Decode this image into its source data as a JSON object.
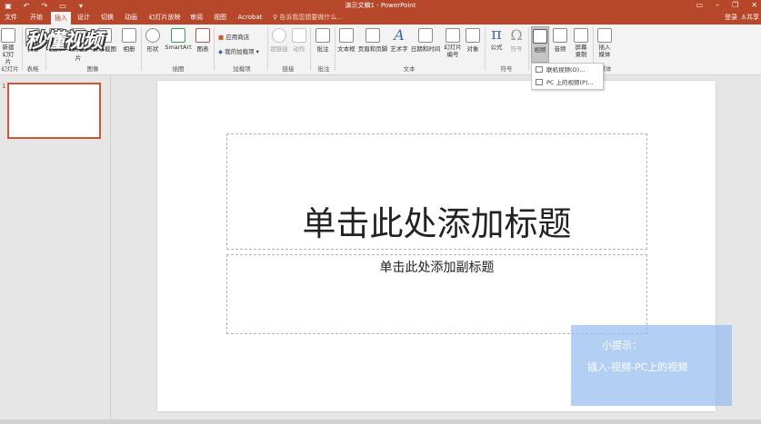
{
  "window": {
    "title": "演示文稿1 - PowerPoint",
    "login": "登录",
    "share": "共享"
  },
  "tabs": [
    "文件",
    "开始",
    "插入",
    "设计",
    "切换",
    "动画",
    "幻灯片放映",
    "审阅",
    "视图",
    "Acrobat"
  ],
  "active_tab": "插入",
  "tell_me": "告诉我您想要做什么...",
  "ribbon": {
    "new_slide": "新建\n幻灯片",
    "table": "表格",
    "picture": "图片",
    "online_picture": "联机图片",
    "screenshot": "屏幕截图",
    "album": "相册",
    "shapes": "形状",
    "smartart": "SmartArt",
    "chart": "图表",
    "store": "应用商店",
    "my_addins": "我的加载项",
    "hyperlink": "超链接",
    "action": "动作",
    "comment": "批注",
    "textbox": "文本框",
    "header_footer": "页眉和页脚",
    "wordart": "艺术字",
    "date_time": "日期和时间",
    "slide_number": "幻灯片\n编号",
    "object": "对象",
    "equation": "公式",
    "symbol": "符号",
    "video": "视频",
    "audio": "音频",
    "screen_record": "屏幕\n录制",
    "insert_media": "插入\n媒体",
    "groups": {
      "slides": "幻灯片",
      "tables": "表格",
      "images": "图像",
      "illustrations": "插图",
      "addins": "加载项",
      "links": "链接",
      "comments": "批注",
      "text": "文本",
      "symbols": "符号",
      "media": "媒体"
    }
  },
  "video_menu": {
    "online_video": "联机视频(O)...",
    "pc_video": "PC 上的视频(P)..."
  },
  "slides_pane": {
    "slide_number": "1"
  },
  "slide": {
    "title_placeholder": "单击此处添加标题",
    "subtitle_placeholder": "单击此处添加副标题"
  },
  "tip": {
    "title": "小提示：",
    "body": "插入-视频-PC上的视频"
  },
  "logo": {
    "text": "秒懂视频"
  },
  "colors": {
    "accent": "#b7472a",
    "tip_bg": "#96bef0"
  }
}
